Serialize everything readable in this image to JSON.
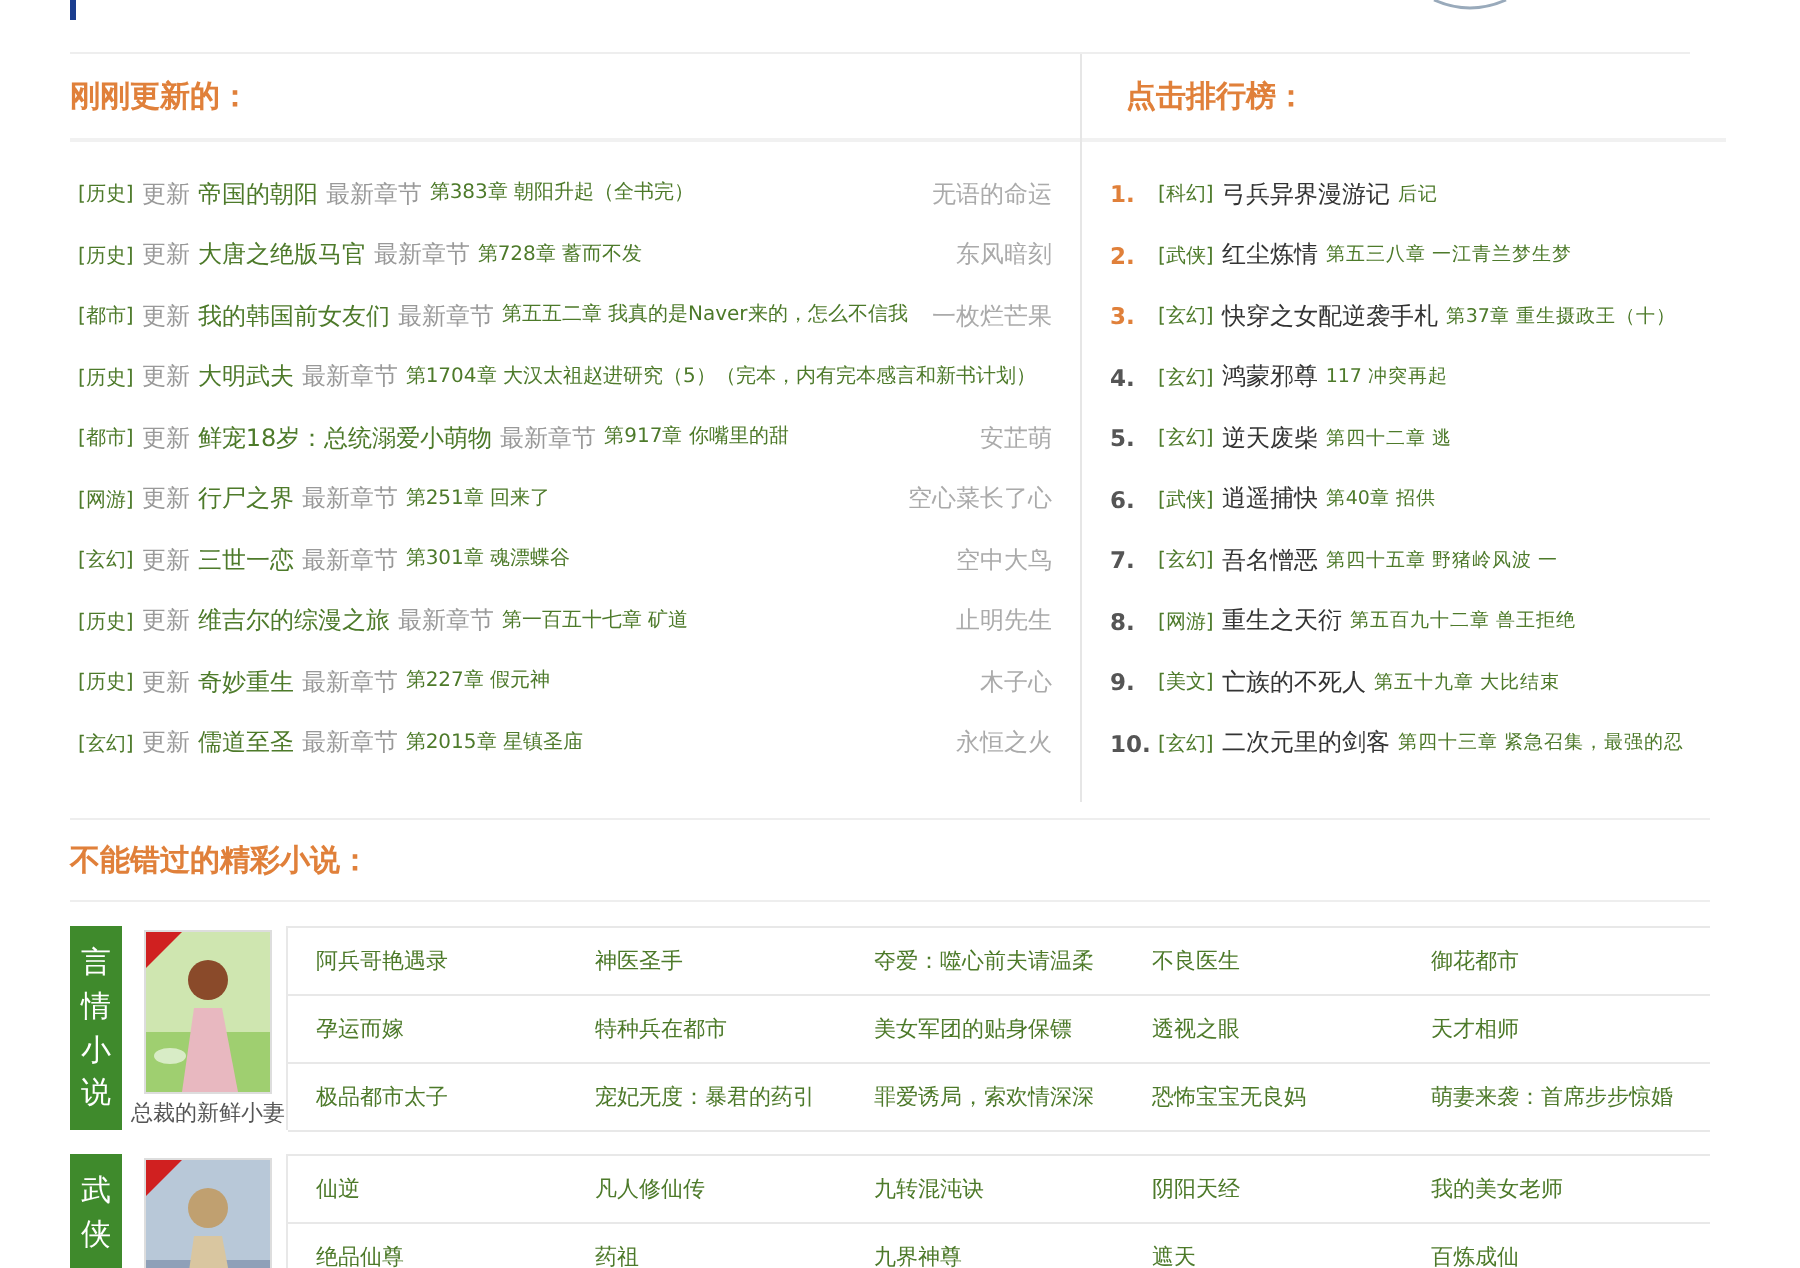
{
  "updates": {
    "title": "刚刚更新的：",
    "rows": [
      {
        "category": "[历史]",
        "verb": "更新",
        "book": "帝国的朝阳",
        "latest_label": "最新章节",
        "chapter": "第383章 朝阳升起（全书完）",
        "author": "无语的命运"
      },
      {
        "category": "[历史]",
        "verb": "更新",
        "book": "大唐之绝版马官",
        "latest_label": "最新章节",
        "chapter": "第728章 蓄而不发",
        "author": "东风暗刻"
      },
      {
        "category": "[都市]",
        "verb": "更新",
        "book": "我的韩国前女友们",
        "latest_label": "最新章节",
        "chapter": "第五五二章 我真的是Naver来的，怎么不信我",
        "author": "一枚烂芒果"
      },
      {
        "category": "[历史]",
        "verb": "更新",
        "book": "大明武夫",
        "latest_label": "最新章节",
        "chapter": "第1704章 大汉太祖赵进研究（5）（完本，内有完本感言和新书计划）"
      },
      {
        "category": "[都市]",
        "verb": "更新",
        "book": "鲜宠18岁：总统溺爱小萌物",
        "latest_label": "最新章节",
        "chapter": "第917章 你嘴里的甜",
        "author": "安芷萌"
      },
      {
        "category": "[网游]",
        "verb": "更新",
        "book": "行尸之界",
        "latest_label": "最新章节",
        "chapter": "第251章 回来了",
        "author": "空心菜长了心"
      },
      {
        "category": "[玄幻]",
        "verb": "更新",
        "book": "三世一恋",
        "latest_label": "最新章节",
        "chapter": "第301章 魂漂蝶谷",
        "author": "空中大鸟"
      },
      {
        "category": "[历史]",
        "verb": "更新",
        "book": "维吉尔的综漫之旅",
        "latest_label": "最新章节",
        "chapter": "第一百五十七章 矿道",
        "author": "止明先生"
      },
      {
        "category": "[历史]",
        "verb": "更新",
        "book": "奇妙重生",
        "latest_label": "最新章节",
        "chapter": "第227章 假元神",
        "author": "木子心"
      },
      {
        "category": "[玄幻]",
        "verb": "更新",
        "book": "儒道至圣",
        "latest_label": "最新章节",
        "chapter": "第2015章 星镇圣庙",
        "author": "永恒之火"
      }
    ]
  },
  "ranking": {
    "title": "点击排行榜：",
    "rows": [
      {
        "rank": "1.",
        "top": true,
        "category": "[科幻]",
        "book": "弓兵异界漫游记",
        "chapter": "后记"
      },
      {
        "rank": "2.",
        "top": true,
        "category": "[武侠]",
        "book": "红尘炼情",
        "chapter": "第五三八章 一江青兰梦生梦"
      },
      {
        "rank": "3.",
        "top": true,
        "category": "[玄幻]",
        "book": "快穿之女配逆袭手札",
        "chapter": "第37章 重生摄政王（十）"
      },
      {
        "rank": "4.",
        "top": false,
        "category": "[玄幻]",
        "book": "鸿蒙邪尊",
        "chapter": "117 冲突再起"
      },
      {
        "rank": "5.",
        "top": false,
        "category": "[玄幻]",
        "book": "逆天废柴",
        "chapter": "第四十二章 逃"
      },
      {
        "rank": "6.",
        "top": false,
        "category": "[武侠]",
        "book": "逍遥捕快",
        "chapter": "第40章 招供"
      },
      {
        "rank": "7.",
        "top": false,
        "category": "[玄幻]",
        "book": "吾名憎恶",
        "chapter": "第四十五章 野猪岭风波 一"
      },
      {
        "rank": "8.",
        "top": false,
        "category": "[网游]",
        "book": "重生之天衍",
        "chapter": "第五百九十二章 兽王拒绝"
      },
      {
        "rank": "9.",
        "top": false,
        "category": "[美文]",
        "book": "亡族的不死人",
        "chapter": "第五十九章 大比结束"
      },
      {
        "rank": "10.",
        "top": false,
        "category": "[玄幻]",
        "book": "二次元里的剑客",
        "chapter": "第四十三章 紧急召集，最强的忍"
      }
    ]
  },
  "featured": {
    "title": "不能错过的精彩小说：",
    "groups": [
      {
        "label": "言情小说",
        "cover_caption": "总裁的新鲜小妻",
        "books": [
          [
            "阿兵哥艳遇录",
            "神医圣手",
            "夺爱：噬心前夫请温柔",
            "不良医生",
            "御花都市"
          ],
          [
            "孕运而嫁",
            "特种兵在都市",
            "美女军团的贴身保镖",
            "透视之眼",
            "天才相师"
          ],
          [
            "极品都市太子",
            "宠妃无度：暴君的药引",
            "罪爱诱局，索欢情深深",
            "恐怖宝宝无良妈",
            "萌妻来袭：首席步步惊婚"
          ]
        ]
      },
      {
        "label": "武侠",
        "books": [
          [
            "仙逆",
            "凡人修仙传",
            "九转混沌诀",
            "阴阳天经",
            "我的美女老师"
          ],
          [
            "绝品仙尊",
            "药祖",
            "九界神尊",
            "遮天",
            "百炼成仙"
          ]
        ]
      }
    ]
  }
}
